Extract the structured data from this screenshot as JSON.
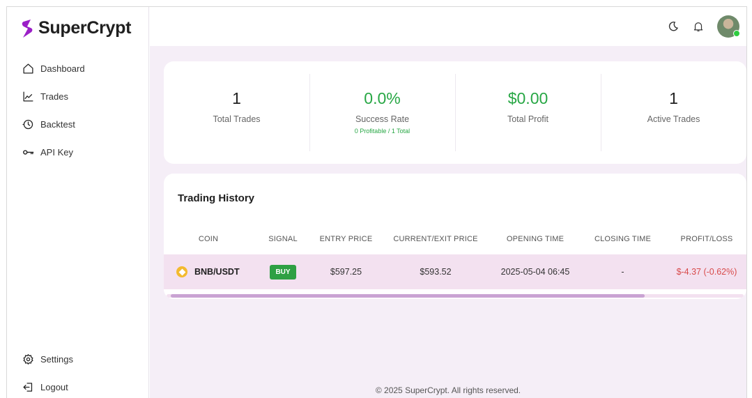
{
  "brand": {
    "name": "SuperCrypt",
    "accent": "#9b1fc7"
  },
  "sidebar": {
    "items": [
      {
        "label": "Dashboard",
        "icon": "home-icon"
      },
      {
        "label": "Trades",
        "icon": "chart-line-icon"
      },
      {
        "label": "Backtest",
        "icon": "history-icon"
      },
      {
        "label": "API Key",
        "icon": "key-icon"
      }
    ],
    "bottom_items": [
      {
        "label": "Settings",
        "icon": "gear-icon"
      },
      {
        "label": "Logout",
        "icon": "logout-icon"
      }
    ]
  },
  "topbar": {
    "icons": [
      "moon-icon",
      "bell-icon",
      "avatar"
    ]
  },
  "stats": [
    {
      "value": "1",
      "label": "Total Trades",
      "sub": ""
    },
    {
      "value": "0.0%",
      "label": "Success Rate",
      "sub": "0 Profitable / 1 Total"
    },
    {
      "value": "$0.00",
      "label": "Total Profit",
      "sub": ""
    },
    {
      "value": "1",
      "label": "Active Trades",
      "sub": ""
    }
  ],
  "history": {
    "title": "Trading History",
    "columns": [
      "COIN",
      "SIGNAL",
      "ENTRY PRICE",
      "CURRENT/EXIT PRICE",
      "OPENING TIME",
      "CLOSING TIME",
      "PROFIT/LOSS"
    ],
    "rows": [
      {
        "coin": "BNB/USDT",
        "signal": "BUY",
        "entry_price": "$597.25",
        "current_price": "$593.52",
        "opening_time": "2025-05-04 06:45",
        "closing_time": "-",
        "profit_loss": "$-4.37 (-0.62%)"
      }
    ]
  },
  "footer": {
    "text": "© 2025 SuperCrypt. All rights reserved."
  },
  "colors": {
    "positive": "#28a745",
    "negative": "#d84a4a",
    "row_highlight": "#f3e1f0",
    "main_bg": "#f5eef7"
  }
}
